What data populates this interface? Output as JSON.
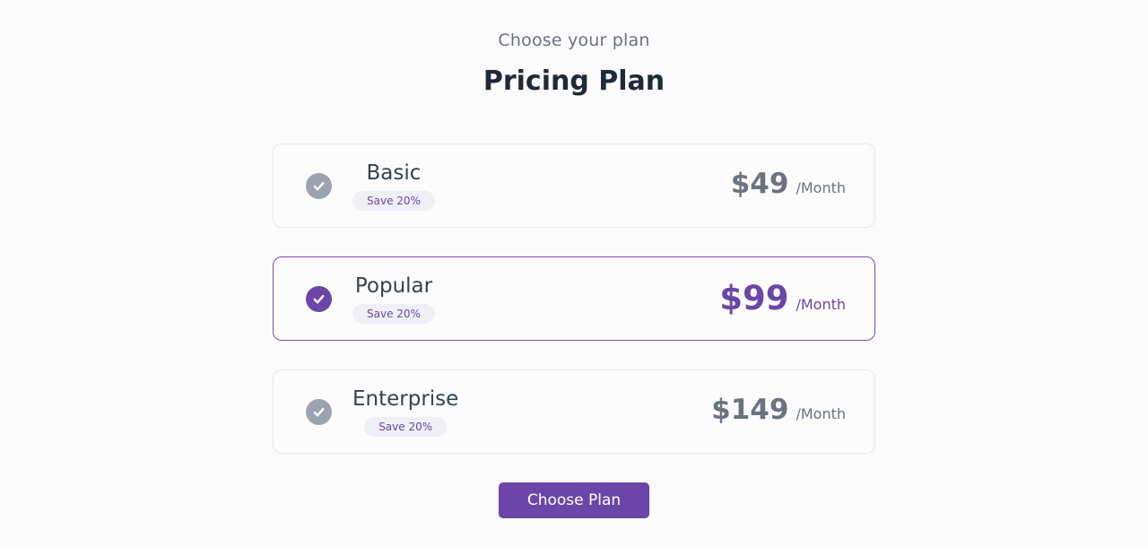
{
  "header": {
    "eyebrow": "Choose your plan",
    "title": "Pricing Plan"
  },
  "plans": [
    {
      "name": "Basic",
      "badge": "Save 20%",
      "price": "$49",
      "period": "/Month",
      "selected": false
    },
    {
      "name": "Popular",
      "badge": "Save 20%",
      "price": "$99",
      "period": "/Month",
      "selected": true
    },
    {
      "name": "Enterprise",
      "badge": "Save 20%",
      "price": "$149",
      "period": "/Month",
      "selected": false
    }
  ],
  "cta": {
    "label": "Choose Plan"
  },
  "colors": {
    "accent": "#6b46a8",
    "muted": "#9ca3af",
    "background": "#fbfbfc"
  },
  "icons": {
    "check": "check-circle-icon"
  }
}
